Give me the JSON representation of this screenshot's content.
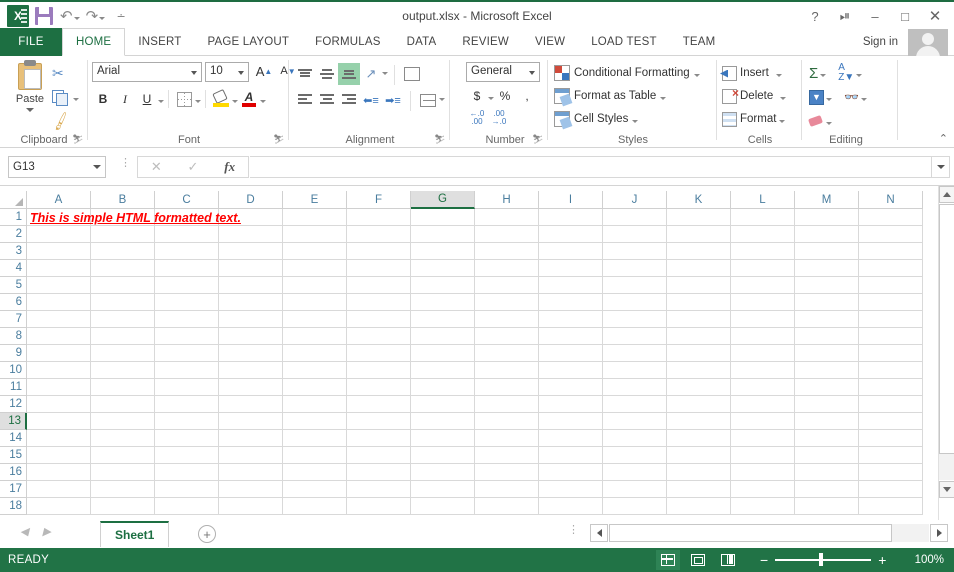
{
  "window": {
    "title": "output.xlsx - Microsoft Excel",
    "help_icon": "?",
    "ribbon_display_icon": "ribbon-display-options",
    "minimize_icon": "–",
    "maximize_icon": "❐",
    "close_icon": "✕"
  },
  "quick_access": {
    "app_icon": "excel-logo",
    "save_label": "Save",
    "undo_label": "Undo",
    "redo_label": "Redo",
    "customize_label": "Customize Quick Access Toolbar"
  },
  "tabs": {
    "file": "FILE",
    "items": [
      {
        "label": "HOME",
        "active": true
      },
      {
        "label": "INSERT",
        "active": false
      },
      {
        "label": "PAGE LAYOUT",
        "active": false
      },
      {
        "label": "FORMULAS",
        "active": false
      },
      {
        "label": "DATA",
        "active": false
      },
      {
        "label": "REVIEW",
        "active": false
      },
      {
        "label": "VIEW",
        "active": false
      },
      {
        "label": "LOAD TEST",
        "active": false
      },
      {
        "label": "TEAM",
        "active": false
      }
    ],
    "sign_in": "Sign in"
  },
  "ribbon": {
    "clipboard": {
      "group_label": "Clipboard",
      "paste_label": "Paste",
      "cut_label": "Cut",
      "copy_label": "Copy",
      "format_painter_label": "Format Painter"
    },
    "font": {
      "group_label": "Font",
      "font_name": "Arial",
      "font_size": "10",
      "grow_label": "A",
      "shrink_label": "A",
      "bold_label": "B",
      "italic_label": "I",
      "underline_label": "U",
      "borders_label": "Borders",
      "fill_color_label": "Fill Color",
      "font_color_label": "A"
    },
    "alignment": {
      "group_label": "Alignment",
      "top_align": "Top Align",
      "middle_align": "Middle Align",
      "bottom_align": "Bottom Align",
      "orientation": "Orientation",
      "align_left": "Align Left",
      "center": "Center",
      "align_right": "Align Right",
      "decrease_indent": "Decrease Indent",
      "increase_indent": "Increase Indent",
      "wrap_text": "Wrap Text",
      "merge_center": "Merge & Center"
    },
    "number": {
      "group_label": "Number",
      "format": "General",
      "currency": "$",
      "percent": "%",
      "comma": "′",
      "increase_decimal": ".00",
      "decrease_decimal": ".00"
    },
    "styles": {
      "group_label": "Styles",
      "conditional_formatting": "Conditional Formatting",
      "format_as_table": "Format as Table",
      "cell_styles": "Cell Styles"
    },
    "cells": {
      "group_label": "Cells",
      "insert": "Insert",
      "delete": "Delete",
      "format": "Format"
    },
    "editing": {
      "group_label": "Editing",
      "autosum": "Σ",
      "fill": "Fill",
      "clear": "Clear",
      "sort_filter": "Sort & Filter",
      "find_select": "Find & Select"
    },
    "collapse_label": "⌃"
  },
  "formula_bar": {
    "name_box_value": "G13",
    "cancel_label": "✕",
    "enter_label": "✓",
    "insert_function_label": "fx",
    "formula_value": "",
    "expand_label": "Expand Formula Bar"
  },
  "sheet": {
    "columns": [
      "A",
      "B",
      "C",
      "D",
      "E",
      "F",
      "G",
      "H",
      "I",
      "J",
      "K",
      "L",
      "M",
      "N"
    ],
    "selected_column": "G",
    "rows": [
      "1",
      "2",
      "3",
      "4",
      "5",
      "6",
      "7",
      "8",
      "9",
      "10",
      "11",
      "12",
      "13",
      "14",
      "15",
      "16",
      "17",
      "18"
    ],
    "selected_row": "13",
    "cells": [
      {
        "ref": "A1",
        "value": "This is simple HTML formatted text.",
        "color": "#ff0000",
        "bold": true,
        "italic": true,
        "underline": true
      }
    ]
  },
  "sheet_tabs": {
    "prev_label": "◀",
    "next_label": "▶",
    "tabs": [
      "Sheet1"
    ],
    "active_tab": "Sheet1",
    "new_sheet_label": "+"
  },
  "status_bar": {
    "status": "READY",
    "view_normal": "Normal",
    "view_page_layout": "Page Layout",
    "view_page_break": "Page Break Preview",
    "zoom_out": "−",
    "zoom_in": "+",
    "zoom_level": "100%"
  },
  "colors": {
    "excel_green": "#217346",
    "accent_green": "#1d6f42",
    "a1_text": "#ff0000",
    "header_blue": "#4a7d9e"
  }
}
